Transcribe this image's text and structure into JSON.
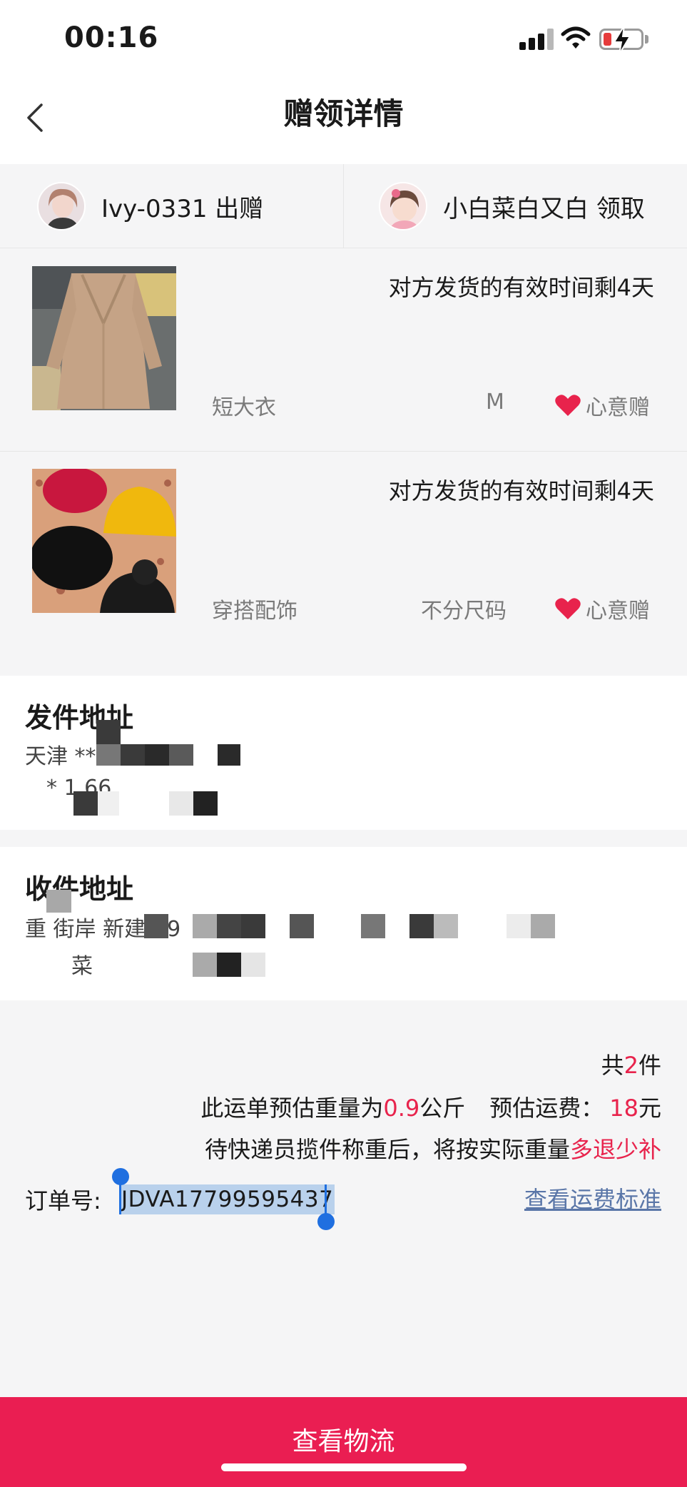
{
  "status_bar": {
    "time": "00:16"
  },
  "header": {
    "title": "赠领详情"
  },
  "parties": {
    "giver": {
      "name": "Ivy-0331",
      "action": "出赠"
    },
    "receiver": {
      "name": "小白菜白又白",
      "action": "领取"
    }
  },
  "items": [
    {
      "deadline": "对方发货的有效时间剩4天",
      "category": "短大衣",
      "size": "M",
      "tag": "心意赠"
    },
    {
      "deadline": "对方发货的有效时间剩4天",
      "category": "穿搭配饰",
      "size": "不分尺码",
      "tag": "心意赠"
    }
  ],
  "sender_address": {
    "title": "发件地址",
    "line1": "天津 ** ***",
    "line2": "* 1      66"
  },
  "receiver_address": {
    "title": "收件地址",
    "line1": "重     街岸         新建街9",
    "line2": "      菜"
  },
  "summary": {
    "count_prefix": "共",
    "count": "2",
    "count_suffix": "件",
    "weight_prefix": "此运单预估重量为",
    "weight": "0.9",
    "weight_unit": "公斤",
    "fee_prefix": "预估运费：",
    "fee": "18",
    "fee_unit": "元",
    "notice_prefix": "待快递员揽件称重后，将按实际重量",
    "notice_highlight": "多退少补"
  },
  "order": {
    "label": "订单号:",
    "number": "JDVA17799595437",
    "fee_link": "查看运费标准"
  },
  "bottom_button": {
    "label": "查看物流"
  },
  "colors": {
    "accent": "#ea1e52",
    "highlight_red": "#e8234c",
    "link": "#5a76a8",
    "selection": "#1f6fe0"
  }
}
